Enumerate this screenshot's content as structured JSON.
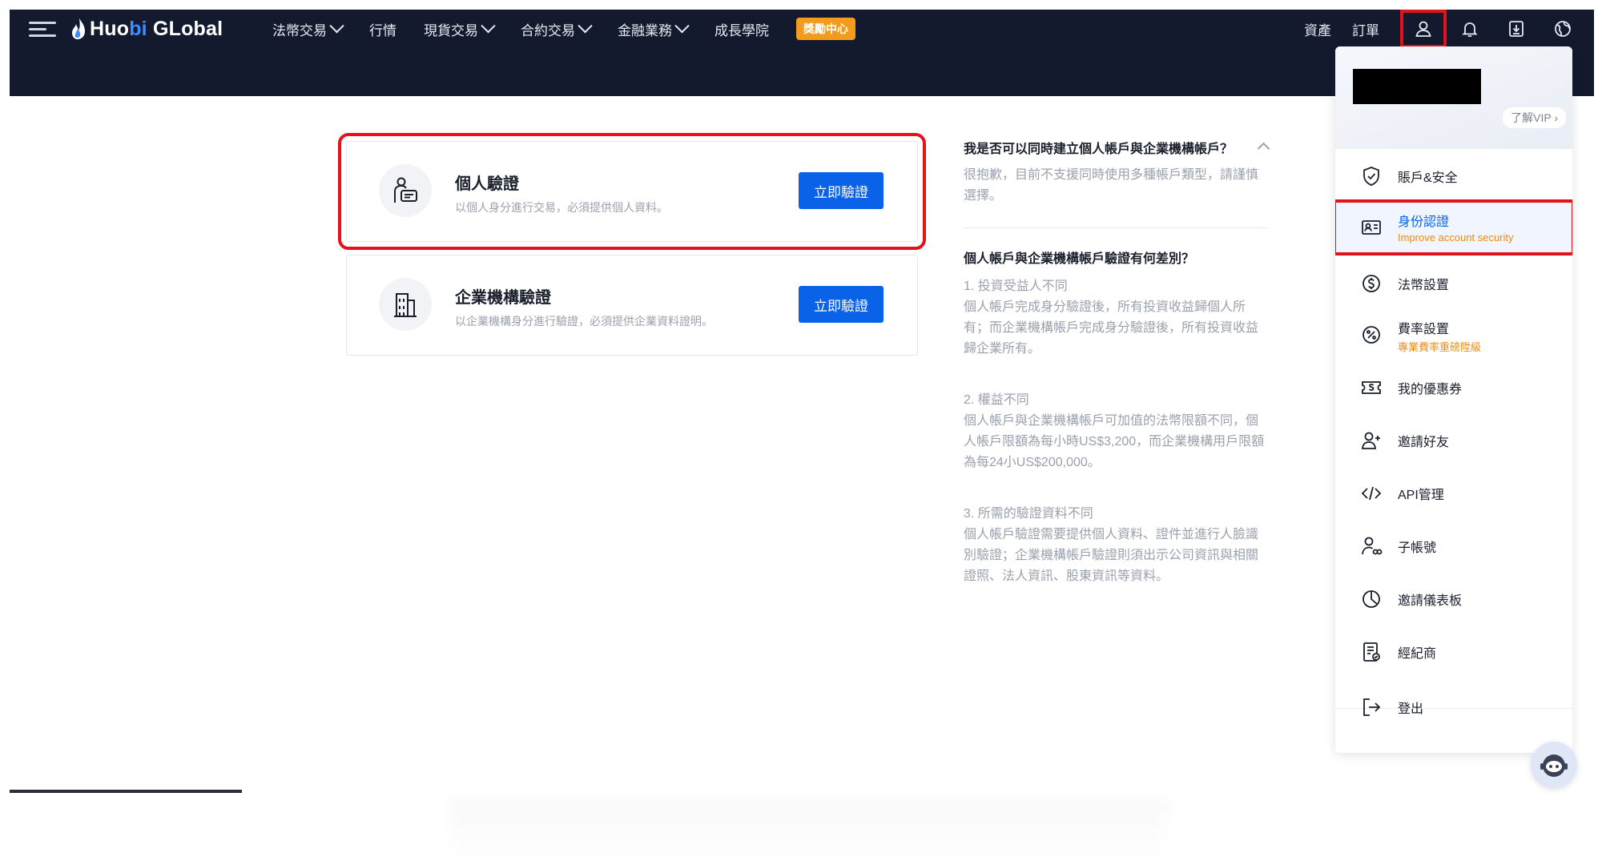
{
  "header": {
    "logo": {
      "part1": "Huo",
      "part2": "bi",
      "part3": " GLobal"
    },
    "nav": [
      {
        "label": "法幣交易",
        "dropdown": true
      },
      {
        "label": "行情",
        "dropdown": false
      },
      {
        "label": "現貨交易",
        "dropdown": true
      },
      {
        "label": "合約交易",
        "dropdown": true
      },
      {
        "label": "金融業務",
        "dropdown": true
      },
      {
        "label": "成長學院",
        "dropdown": false
      }
    ],
    "badge": "獎勵中心",
    "right": {
      "assets": "資產",
      "orders": "訂單"
    },
    "icons": [
      "user-icon",
      "bell-icon",
      "download-icon",
      "globe-icon"
    ]
  },
  "cards": [
    {
      "title": "個人驗證",
      "desc": "以個人身分進行交易，必須提供個人資料。",
      "button": "立即驗證",
      "icon": "person-id-icon"
    },
    {
      "title": "企業機構驗證",
      "desc": "以企業機構身分進行驗證，必須提供企業資料證明。",
      "button": "立即驗證",
      "icon": "building-icon"
    }
  ],
  "faq": {
    "q1": "我是否可以同時建立個人帳戶與企業機構帳戶？",
    "a1": "很抱歉，目前不支援同時使用多種帳戶類型，請謹慎選擇。",
    "q2": "個人帳戶與企業機構帳戶驗證有何差別？",
    "blocks": [
      {
        "title": "1. 投資受益人不同",
        "text": "個人帳戶完成身分驗證後，所有投資收益歸個人所有；而企業機構帳戶完成身分驗證後，所有投資收益歸企業所有。"
      },
      {
        "title": "2. 權益不同",
        "text": "個人帳戶與企業機構帳戶可加值的法幣限額不同，個人帳戶限額為每小時US$3,200，而企業機構用戶限額為每24小US$200,000。"
      },
      {
        "title": "3. 所需的驗證資料不同",
        "text": "個人帳戶驗證需要提供個人資料、證件並進行人臉識別驗證；企業機構帳戶驗證則須出示公司資訊與相關證照、法人資訊、股東資訊等資料。"
      }
    ]
  },
  "dropdown": {
    "vip": "了解VIP",
    "items": [
      {
        "label": "賬戶&安全",
        "icon": "shield-check-icon",
        "sub": ""
      },
      {
        "label": "身份認證",
        "icon": "id-card-icon",
        "sub": "Improve account security"
      },
      {
        "label": "法幣設置",
        "icon": "dollar-circle-icon",
        "sub": ""
      },
      {
        "label": "費率設置",
        "icon": "percent-icon",
        "sub": "專業費率重磅陞級"
      },
      {
        "label": "我的優惠券",
        "icon": "coupon-icon",
        "sub": ""
      },
      {
        "label": "邀請好友",
        "icon": "user-plus-icon",
        "sub": ""
      },
      {
        "label": "API管理",
        "icon": "code-icon",
        "sub": ""
      },
      {
        "label": "子帳號",
        "icon": "sub-account-icon",
        "sub": ""
      },
      {
        "label": "邀請儀表板",
        "icon": "pie-chart-icon",
        "sub": ""
      },
      {
        "label": "經紀商",
        "icon": "broker-icon",
        "sub": ""
      },
      {
        "label": "登出",
        "icon": "logout-icon",
        "sub": ""
      }
    ]
  },
  "colors": {
    "nav_bg": "#141a2e",
    "primary": "#0a62e8",
    "badge": "#f29b1d",
    "highlight": "#e3121b",
    "sub_text": "#f08a12"
  }
}
